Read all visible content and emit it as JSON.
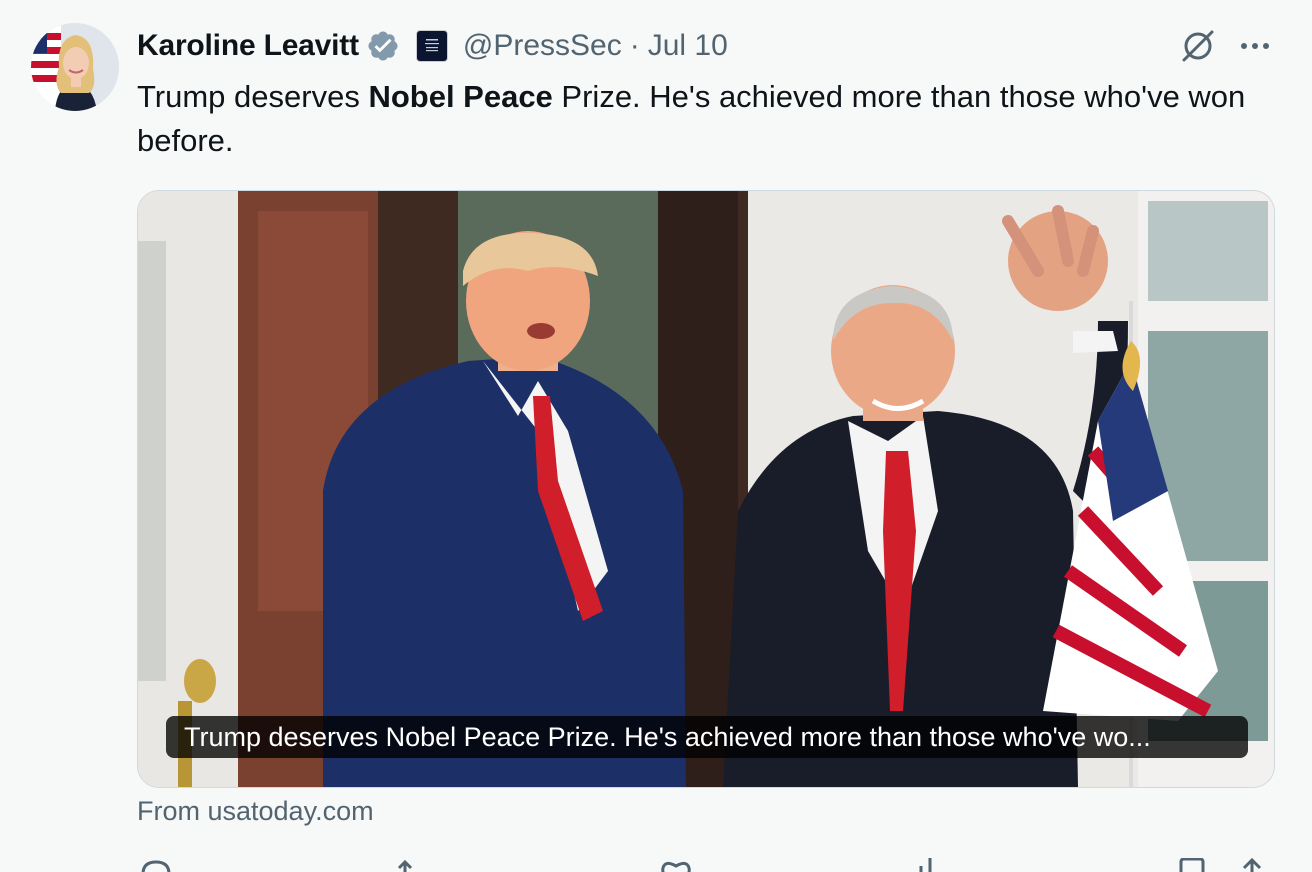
{
  "post": {
    "author_name": "Karoline Leavitt",
    "handle": "@PressSec",
    "separator": "·",
    "date": "Jul 10",
    "text_before": "Trump deserves ",
    "text_bold": "Nobel Peace",
    "text_after": " Prize. He's achieved more than those who've won before."
  },
  "media": {
    "caption": "Trump deserves Nobel Peace Prize. He's achieved more than those who've wo..."
  },
  "source": "From usatoday.com",
  "icons": {
    "verified": "verified-badge-icon",
    "affiliation": "white-house-badge-icon",
    "grok": "grok-icon",
    "more": "more-options-icon",
    "actions": [
      "reply-icon",
      "repost-icon",
      "like-icon",
      "views-icon",
      "bookmark-icon",
      "share-icon"
    ]
  },
  "colors": {
    "background": "#f7f9f9",
    "text": "#0f1419",
    "secondary_text": "#536471",
    "verified_badge": "#829aab",
    "caption_bg": "#000000"
  }
}
